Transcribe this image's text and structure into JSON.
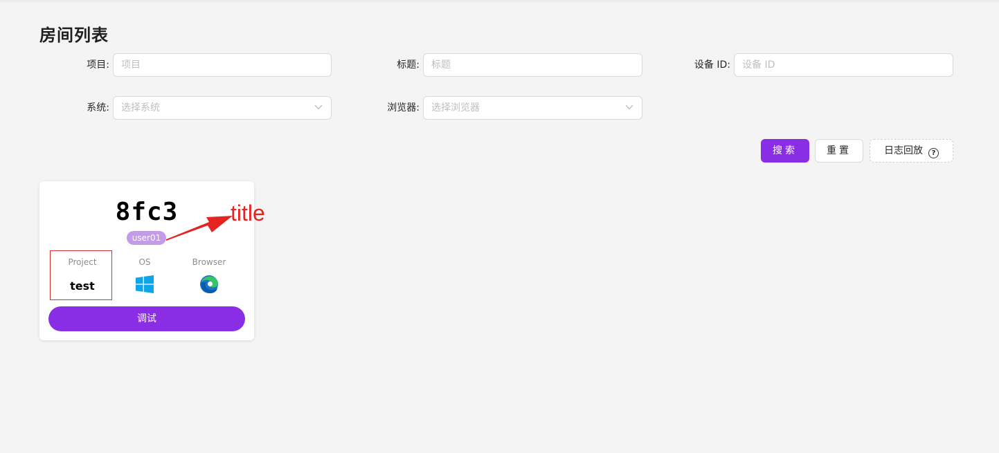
{
  "page": {
    "title": "房间列表"
  },
  "filters": {
    "project": {
      "label": "项目",
      "placeholder": "项目"
    },
    "title": {
      "label": "标题",
      "placeholder": "标题"
    },
    "device_id": {
      "label": "设备 ID",
      "placeholder": "设备 ID"
    },
    "os": {
      "label": "系统",
      "placeholder": "选择系统"
    },
    "browser": {
      "label": "浏览器",
      "placeholder": "选择浏览器"
    },
    "colon": ":"
  },
  "actions": {
    "search": "搜索",
    "reset": "重置",
    "log_replay": "日志回放",
    "help_glyph": "?"
  },
  "room_card": {
    "title": "8fc3",
    "user": "user01",
    "project_label": "Project",
    "project_value": "test",
    "os_label": "OS",
    "os_icon": "windows-icon",
    "browser_label": "Browser",
    "browser_icon": "edge-icon",
    "debug_button": "调试"
  },
  "annotation": {
    "text": "title",
    "color": "#e52320"
  },
  "colors": {
    "accent": "#8a2ee6",
    "badge": "#c39be8",
    "highlight": "#d32f2f"
  }
}
